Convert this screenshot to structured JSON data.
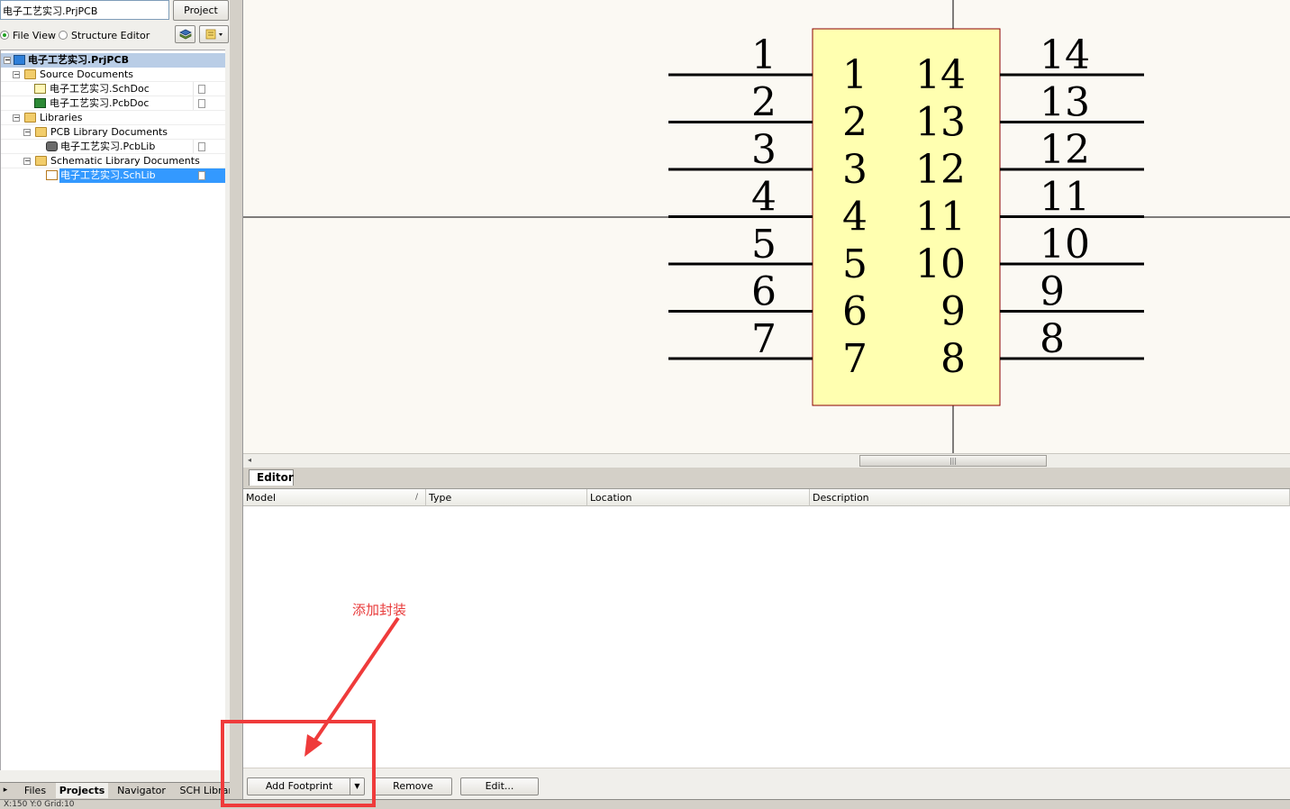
{
  "left_panel": {
    "project_field": "电子工艺实习.PrjPCB",
    "project_button": "Project",
    "view_options": {
      "file_view": "File View",
      "structure_editor": "Structure Editor"
    },
    "tree": {
      "project": "电子工艺实习.PrjPCB",
      "source_documents": "Source Documents",
      "schdoc": "电子工艺实习.SchDoc",
      "pcbdoc": "电子工艺实习.PcbDoc",
      "libraries": "Libraries",
      "pcb_library_documents": "PCB Library Documents",
      "pcblib": "电子工艺实习.PcbLib",
      "schematic_library_documents": "Schematic Library Documents",
      "schlib": "电子工艺实习.SchLib"
    },
    "tabs": {
      "files": "Files",
      "projects": "Projects",
      "navigator": "Navigator",
      "sch_library": "SCH Library"
    }
  },
  "canvas": {
    "component_fill": "#ffffb0",
    "component_border": "#8b0000",
    "pin_color": "#000000",
    "pins_left": {
      "outer": [
        "1",
        "2",
        "3",
        "4",
        "5",
        "6",
        "7"
      ],
      "inner": [
        "1",
        "2",
        "3",
        "4",
        "5",
        "6",
        "7"
      ]
    },
    "pins_right": {
      "outer": [
        "14",
        "13",
        "12",
        "11",
        "10",
        "9",
        "8"
      ],
      "inner": [
        "14",
        "13",
        "12",
        "11",
        "10",
        "9",
        "8"
      ]
    }
  },
  "editor": {
    "tab": "Editor",
    "columns": {
      "model": "Model",
      "type": "Type",
      "location": "Location",
      "description": "Description"
    },
    "sort_indicator": "/",
    "buttons": {
      "add_footprint": "Add Footprint",
      "remove": "Remove",
      "edit": "Edit..."
    }
  },
  "status": {
    "text": "X:150 Y:0 Grid:10"
  },
  "annotation": {
    "text": "添加封装",
    "color": "#e83a3a"
  }
}
